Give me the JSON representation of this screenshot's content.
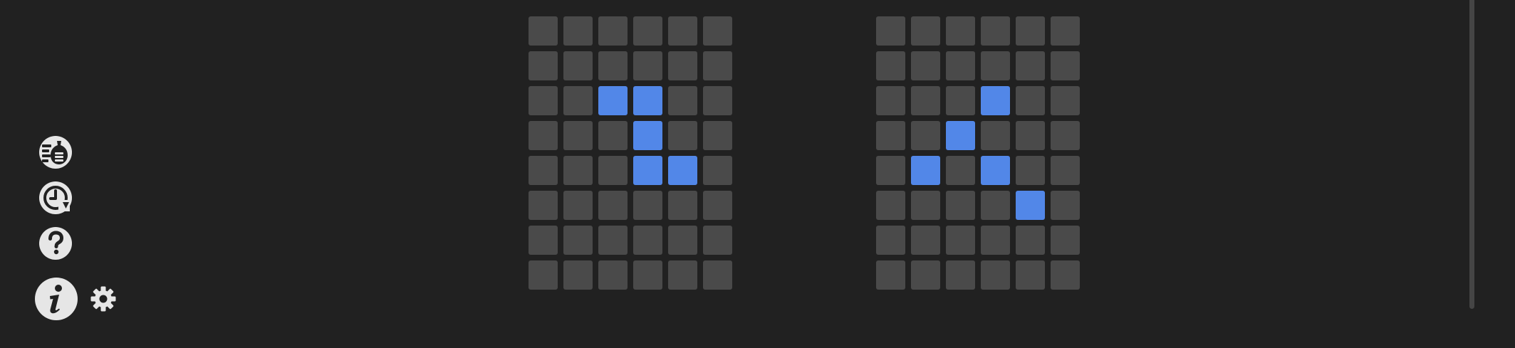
{
  "theme": {
    "background": "#212121",
    "cell_off": "#4a4a4a",
    "cell_on": "#5287e8",
    "icon_fill": "#e6e6e6"
  },
  "sidebar": {
    "icons": [
      "stats-icon",
      "history-icon",
      "help-icon",
      "info-icon",
      "settings-icon"
    ]
  },
  "grids": [
    {
      "rows": 8,
      "cols": 6,
      "on": [
        [
          2,
          2
        ],
        [
          2,
          3
        ],
        [
          3,
          3
        ],
        [
          4,
          3
        ],
        [
          4,
          4
        ]
      ]
    },
    {
      "rows": 8,
      "cols": 6,
      "on": [
        [
          2,
          3
        ],
        [
          3,
          2
        ],
        [
          4,
          1
        ],
        [
          4,
          3
        ],
        [
          5,
          4
        ]
      ]
    }
  ]
}
